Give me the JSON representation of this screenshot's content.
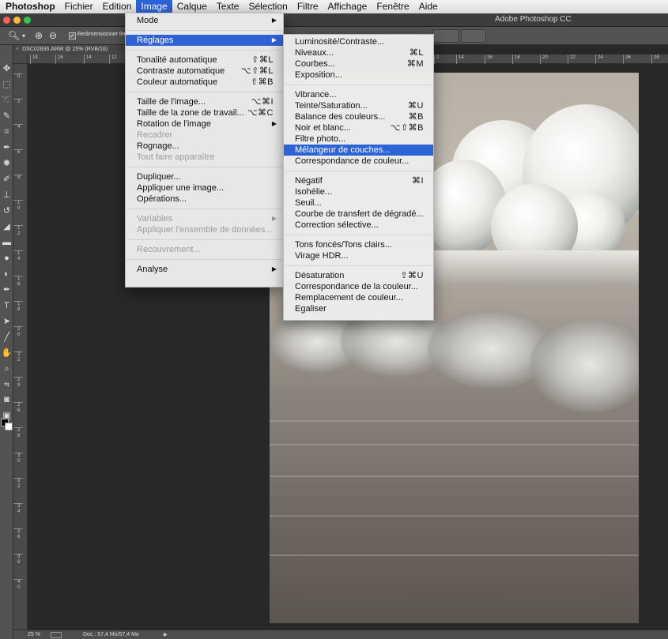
{
  "menubar": {
    "items": [
      "Photoshop",
      "Fichier",
      "Edition",
      "Image",
      "Calque",
      "Texte",
      "Sélection",
      "Filtre",
      "Affichage",
      "Fenêtre",
      "Aide"
    ],
    "active_index": 3
  },
  "titlebar": {
    "title": "Adobe Photoshop CC"
  },
  "options": {
    "resize_label": "Redimensionner fen"
  },
  "document": {
    "tab_label": "DSC02836.ARW @ 25% (RVB/16)"
  },
  "rulers": {
    "h": [
      "18",
      "16",
      "14",
      "12",
      "2",
      "14",
      "16",
      "18",
      "20",
      "22",
      "24",
      "26",
      "28"
    ],
    "v": [
      "0",
      "2",
      "4",
      "6",
      "8",
      "1 0",
      "1 2",
      "1 4",
      "1 6",
      "1 8",
      "2 0",
      "2 2",
      "2 4",
      "2 6",
      "2 8",
      "3 0",
      "3 2",
      "3 4",
      "3 6",
      "3 8",
      "4 0"
    ]
  },
  "image_menu": [
    {
      "label": "Mode",
      "arrow": true
    },
    {
      "sep": true
    },
    {
      "label": "Réglages",
      "arrow": true,
      "highlight": true
    },
    {
      "sep": true
    },
    {
      "label": "Tonalité automatique",
      "shortcut": "⇧⌘L"
    },
    {
      "label": "Contraste automatique",
      "shortcut": "⌥⇧⌘L"
    },
    {
      "label": "Couleur automatique",
      "shortcut": "⇧⌘B"
    },
    {
      "sep": true
    },
    {
      "label": "Taille de l'image...",
      "shortcut": "⌥⌘I"
    },
    {
      "label": "Taille de la zone de travail...",
      "shortcut": "⌥⌘C"
    },
    {
      "label": "Rotation de l'image",
      "arrow": true
    },
    {
      "label": "Recadrer",
      "disabled": true
    },
    {
      "label": "Rognage..."
    },
    {
      "label": "Tout faire apparaître",
      "disabled": true
    },
    {
      "sep": true
    },
    {
      "label": "Dupliquer..."
    },
    {
      "label": "Appliquer une image..."
    },
    {
      "label": "Opérations..."
    },
    {
      "sep": true
    },
    {
      "label": "Variables",
      "arrow": true,
      "disabled": true
    },
    {
      "label": "Appliquer l'ensemble de données...",
      "disabled": true
    },
    {
      "sep": true
    },
    {
      "label": "Recouvrement...",
      "disabled": true
    },
    {
      "sep": true
    },
    {
      "label": "Analyse",
      "arrow": true
    }
  ],
  "reglages_menu": [
    {
      "label": "Luminosité/Contraste..."
    },
    {
      "label": "Niveaux...",
      "shortcut": "⌘L"
    },
    {
      "label": "Courbes...",
      "shortcut": "⌘M"
    },
    {
      "label": "Exposition..."
    },
    {
      "sep": true
    },
    {
      "label": "Vibrance..."
    },
    {
      "label": "Teinte/Saturation...",
      "shortcut": "⌘U"
    },
    {
      "label": "Balance des couleurs...",
      "shortcut": "⌘B"
    },
    {
      "label": "Noir et blanc...",
      "shortcut": "⌥⇧⌘B"
    },
    {
      "label": "Filtre photo..."
    },
    {
      "label": "Mélangeur de couches...",
      "highlight": true
    },
    {
      "label": "Correspondance de couleur..."
    },
    {
      "sep": true
    },
    {
      "label": "Négatif",
      "shortcut": "⌘I"
    },
    {
      "label": "Isohélie..."
    },
    {
      "label": "Seuil..."
    },
    {
      "label": "Courbe de transfert de dégradé..."
    },
    {
      "label": "Correction sélective..."
    },
    {
      "sep": true
    },
    {
      "label": "Tons foncés/Tons clairs..."
    },
    {
      "label": "Virage HDR..."
    },
    {
      "sep": true
    },
    {
      "label": "Désaturation",
      "shortcut": "⇧⌘U"
    },
    {
      "label": "Correspondance de la couleur..."
    },
    {
      "label": "Remplacement de couleur..."
    },
    {
      "label": "Egaliser"
    }
  ],
  "statusbar": {
    "zoom": "25 %",
    "doc_info": "Doc : 57,4 Mo/57,4 Mo"
  },
  "colors": {
    "highlight": "#2d63d6",
    "foreground": "#000000",
    "background": "#ffffff"
  }
}
